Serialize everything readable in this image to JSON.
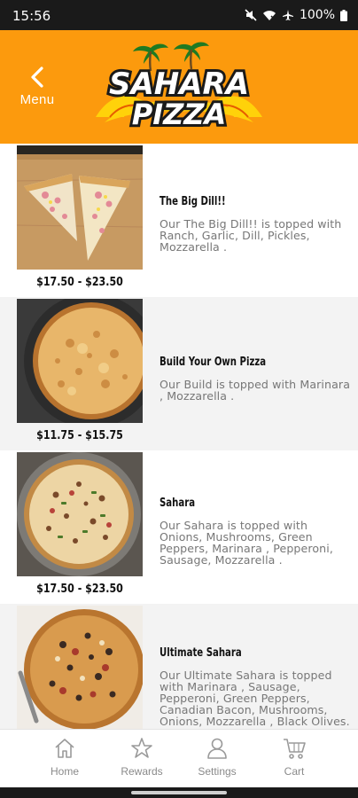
{
  "status_bar": {
    "time": "15:56",
    "battery": "100%",
    "icons": [
      "mute-icon",
      "wifi-icon",
      "airplane-icon",
      "battery-icon"
    ]
  },
  "header": {
    "back_label": "Menu",
    "back_icon": "chevron-left-icon",
    "logo_line1": "SAHARA",
    "logo_line2": "PIZZA",
    "background_color": "#fc9a0d"
  },
  "menu_items": [
    {
      "name": "The Big Dill!!",
      "description": "Our The Big Dill!! is topped with Ranch, Garlic, Dill, Pickles, Mozzarella .",
      "price": "$17.50 - $23.50",
      "image": "pizza-slices-photo"
    },
    {
      "name": "Build Your Own Pizza",
      "description": "Our Build is topped with Marinara , Mozzarella .",
      "price": "$11.75 - $15.75",
      "image": "cheese-pizza-photo"
    },
    {
      "name": "Sahara",
      "description": "Our Sahara is topped with Onions, Mushrooms, Green Peppers, Marinara , Pepperoni, Sausage, Mozzarella .",
      "price": "$17.50 - $23.50",
      "image": "supreme-pizza-photo"
    },
    {
      "name": "Ultimate Sahara",
      "description": "Our Ultimate Sahara is topped with Marinara , Sausage, Pepperoni, Green Peppers, Canadian Bacon, Mushrooms, Onions, Mozzarella , Black Olives.",
      "price": "",
      "image": "loaded-pizza-photo"
    }
  ],
  "bottom_nav": [
    {
      "label": "Home",
      "icon": "home-icon"
    },
    {
      "label": "Rewards",
      "icon": "star-icon"
    },
    {
      "label": "Settings",
      "icon": "person-icon"
    },
    {
      "label": "Cart",
      "icon": "cart-icon"
    }
  ],
  "colors": {
    "accent": "#fc9a0d",
    "alt_row": "#f3f3f3",
    "description_text": "#777777"
  }
}
